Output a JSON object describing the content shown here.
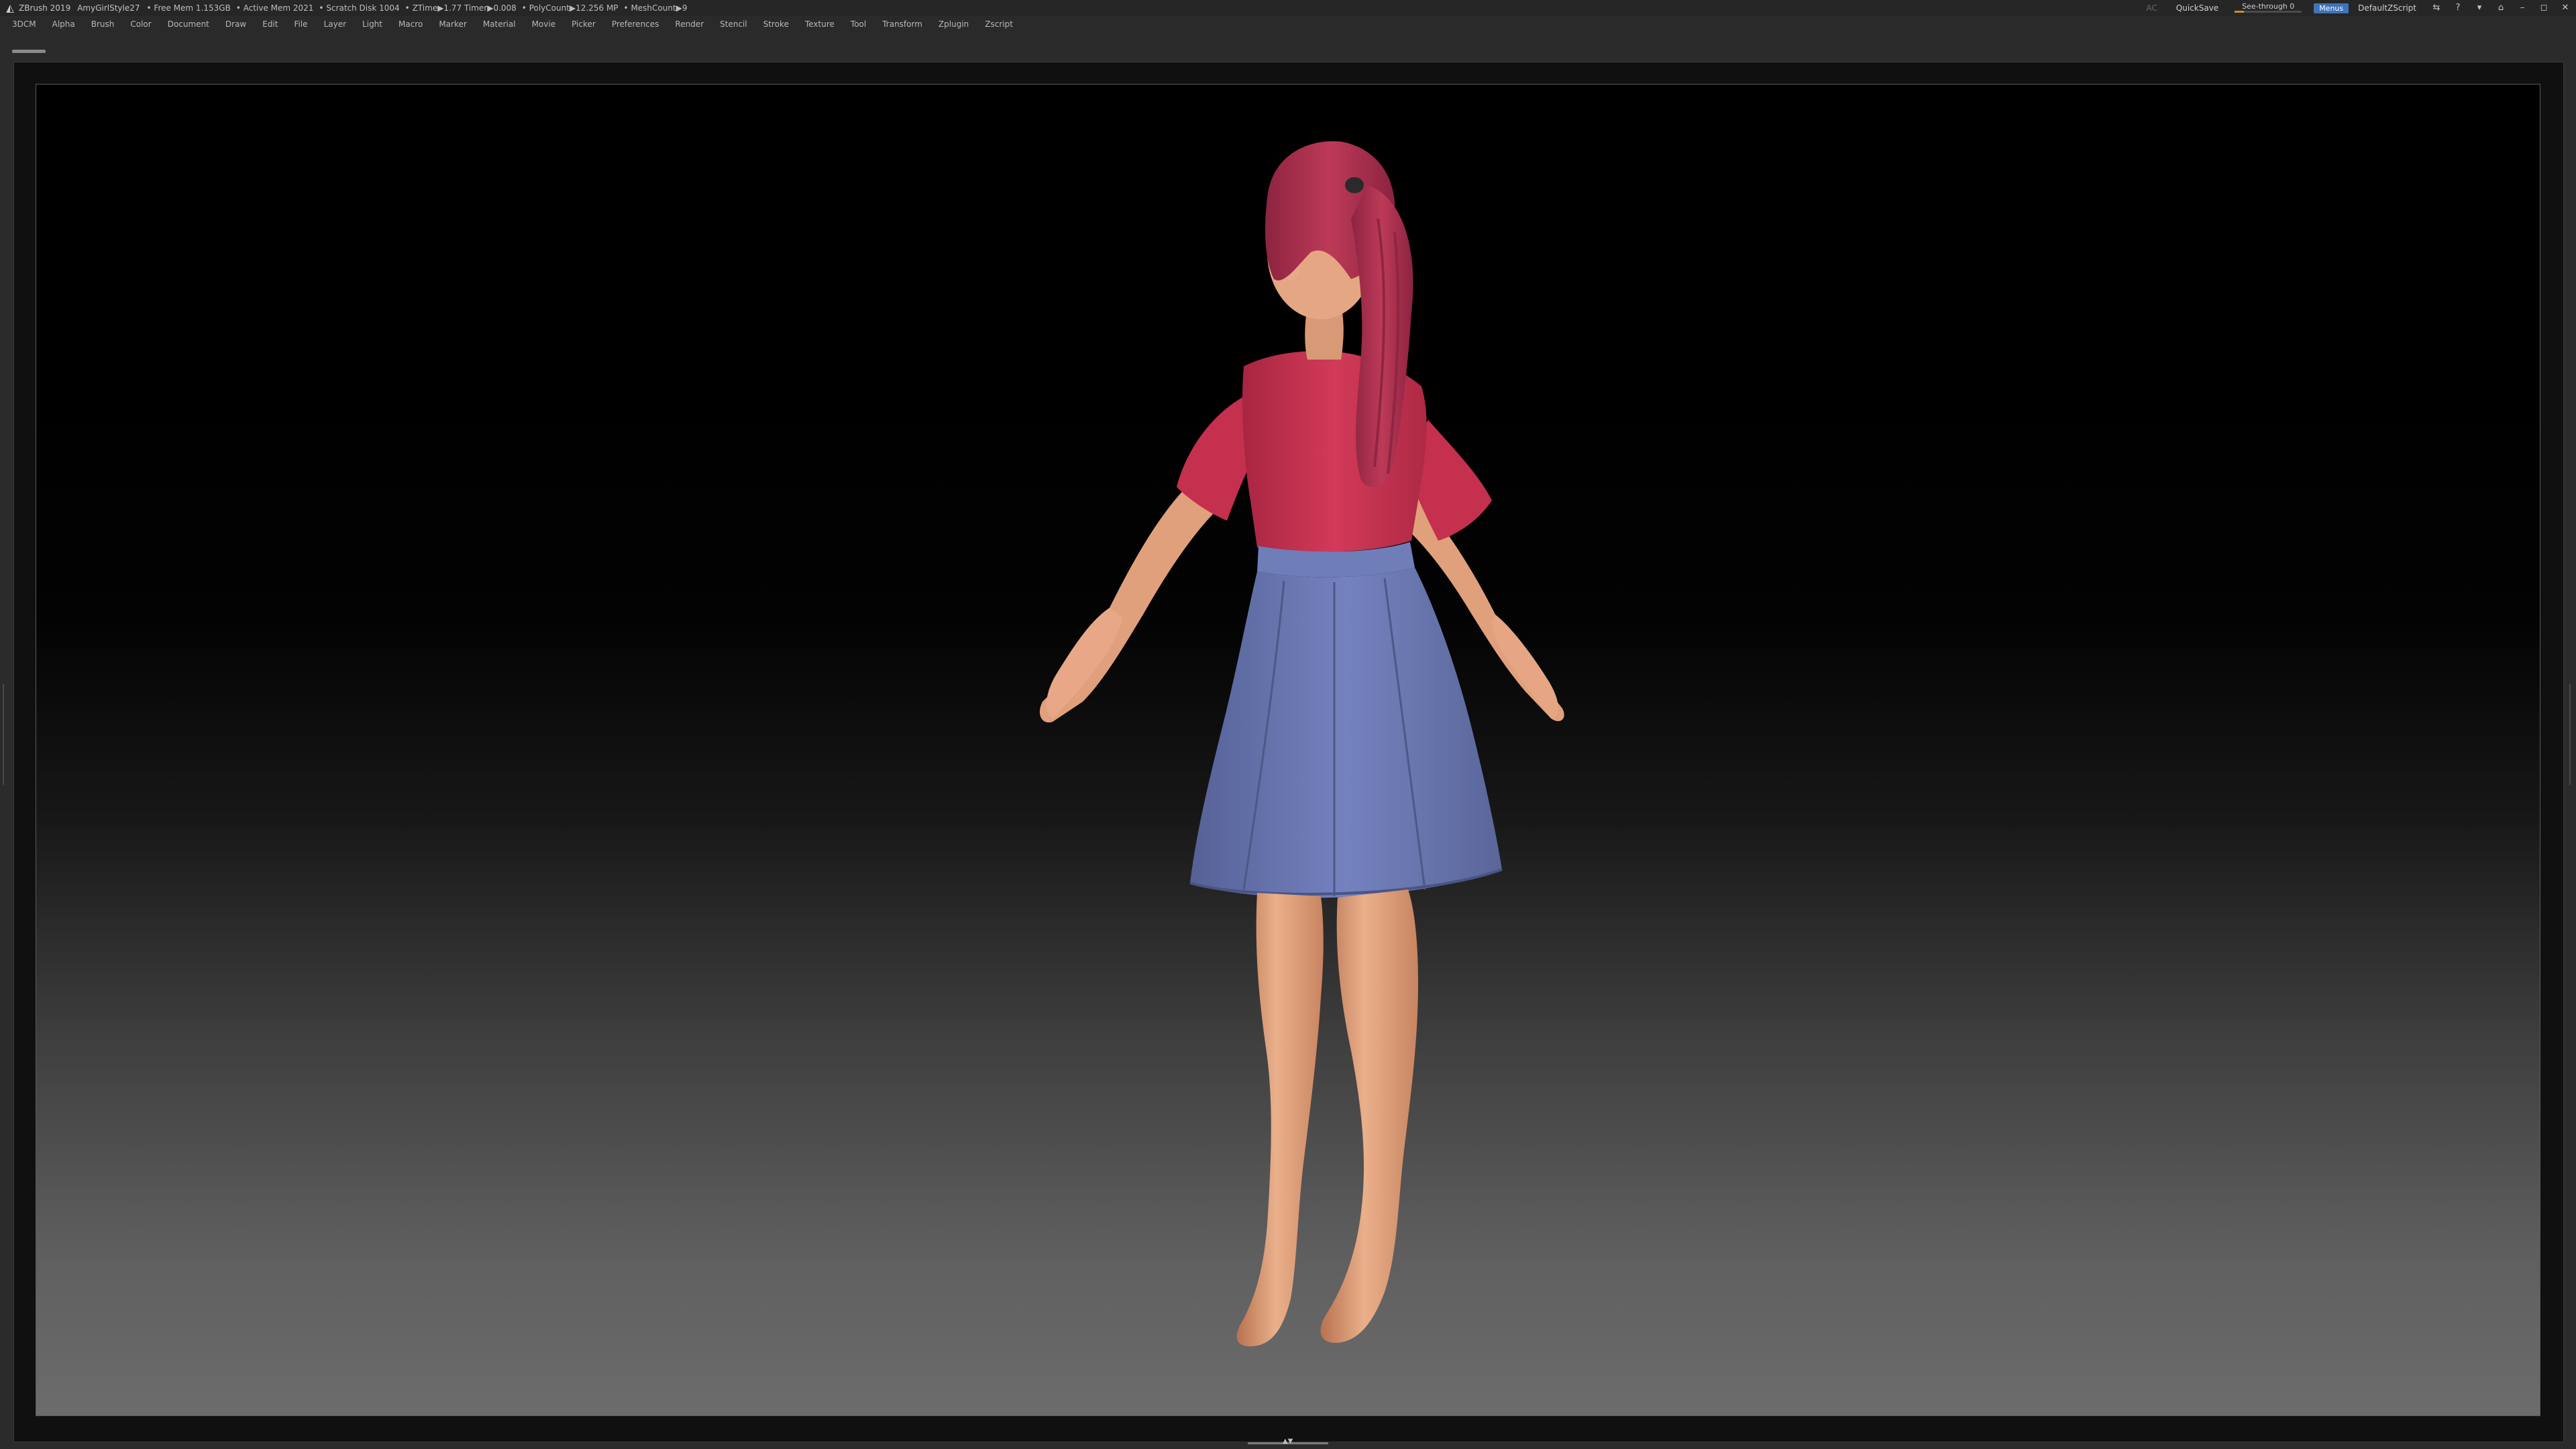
{
  "titlebar": {
    "app": "ZBrush 2019",
    "document": "AmyGirlStyle27",
    "stats": [
      "• Free Mem 1.153GB",
      "• Active Mem 2021",
      "• Scratch Disk 1004",
      "• ZTime▶1.77 Timer▶0.008",
      "• PolyCount▶12.256 MP",
      "• MeshCount▶9"
    ],
    "ac": "AC",
    "quicksave": "QuickSave",
    "seethrough": "See-through 0",
    "seethrough_level": 0,
    "menus": "Menus",
    "script": "DefaultZScript",
    "accent_color": "#d08a30",
    "menus_color": "#3e74b8"
  },
  "menubar": {
    "items": [
      "3DCM",
      "Alpha",
      "Brush",
      "Color",
      "Document",
      "Draw",
      "Edit",
      "File",
      "Layer",
      "Light",
      "Macro",
      "Marker",
      "Material",
      "Movie",
      "Picker",
      "Preferences",
      "Render",
      "Stencil",
      "Stroke",
      "Texture",
      "Tool",
      "Transform",
      "Zplugin",
      "Zscript"
    ]
  },
  "icons": {
    "window_controls": [
      "palette-icon",
      "help-icon",
      "layout-icon",
      "minimize-icon",
      "maximize-icon",
      "close-icon"
    ]
  },
  "model": {
    "skin_color": "#e6a882",
    "hair_color": "#b0344f",
    "shirt_color": "#c93350",
    "skirt_color": "#6a78b2"
  }
}
